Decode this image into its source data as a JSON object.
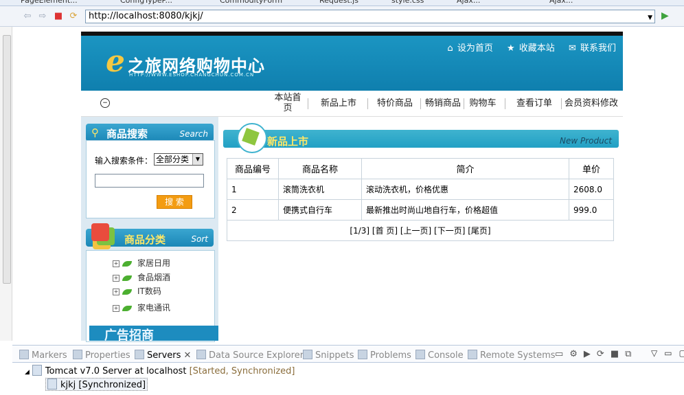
{
  "browser": {
    "tabs": [
      "PageElement...",
      "ConfigTypeP...",
      "CommodityForm",
      "Request.js",
      "style.css",
      "Ajax...",
      "Ajax..."
    ],
    "url": "http://localhost:8080/kjkj/"
  },
  "site": {
    "logo_letter": "e",
    "logo_text": "之旅网络购物中心",
    "logo_url": "HTTP://WWW.ESHOP.CHANGCHUN.COM.CN",
    "top_links": [
      "设为首页",
      "收藏本站",
      "联系我们"
    ],
    "menu": [
      "本站首页",
      "新品上市",
      "特价商品",
      "畅销商品",
      "购物车",
      "查看订单",
      "会员资料修改"
    ],
    "search": {
      "title": "商品搜索",
      "title_en": "Search",
      "condition_label": "输入搜索条件：",
      "select_value": "全部分类",
      "input_value": "",
      "button": "搜 索"
    },
    "category": {
      "title": "商品分类",
      "title_en": "Sort",
      "items": [
        "家居日用",
        "食品烟酒",
        "IT数码",
        "家电通讯"
      ]
    },
    "ad_text": "广告招商",
    "products": {
      "title": "新品上市",
      "title_en": "New Product",
      "headers": [
        "商品编号",
        "商品名称",
        "简介",
        "单价"
      ],
      "rows": [
        [
          "1",
          "滚筒洗衣机",
          "滚动洗衣机，价格优惠",
          "2608.0"
        ],
        [
          "2",
          "便携式自行车",
          "最新推出时尚山地自行车，价格超值",
          "999.0"
        ]
      ],
      "pager": "[1/3]  [首 页] [上一页] [下一页] [尾页]"
    }
  },
  "eclipse": {
    "view_tabs": [
      "Markers",
      "Properties",
      "Servers",
      "Data Source Explorer",
      "Snippets",
      "Problems",
      "Console",
      "Remote Systems"
    ],
    "server_name": "Tomcat v7.0 Server at localhost",
    "server_status": "[Started, Synchronized]",
    "module_name": "kjkj",
    "module_status": "[Synchronized]"
  },
  "colors": {
    "banner": "#1b95c2",
    "accent_yellow": "#ffe766",
    "link_orange": "#f39c12"
  }
}
